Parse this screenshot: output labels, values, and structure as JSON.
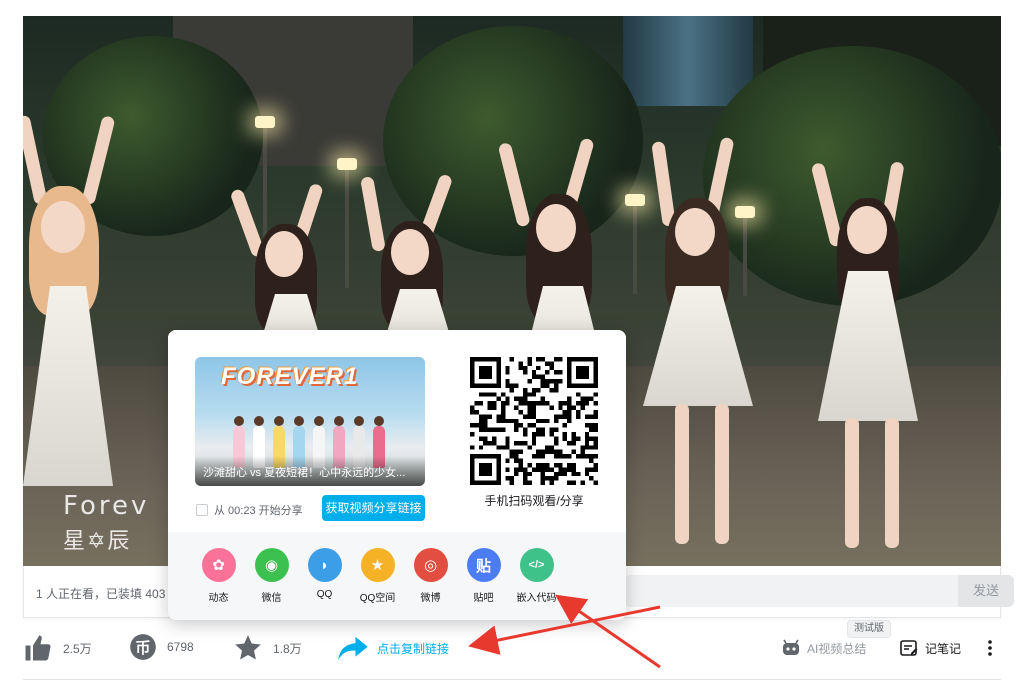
{
  "video": {
    "watermark_title": "Forev",
    "watermark_sub": "星✡辰",
    "progress_fraction": 0.0
  },
  "danmaku_bar": {
    "viewers_text": "1 人正在看，已装填 403",
    "send_label": "发送"
  },
  "share_popup": {
    "thumb_logo": "FOREVER1",
    "thumb_caption": "沙滩甜心 vs 夏夜短裙！心中永远的少女...",
    "start_share_label": "从 00:23 开始分享",
    "get_link_label": "获取视频分享链接",
    "qr_label": "手机扫码观看/分享",
    "apps": [
      {
        "label": "动态",
        "icon": "pinwheel-icon",
        "color": "#fb7299"
      },
      {
        "label": "微信",
        "icon": "wechat-icon",
        "color": "#3cc04f"
      },
      {
        "label": "QQ",
        "icon": "qq-icon",
        "color": "#3d9ee8"
      },
      {
        "label": "QQ空间",
        "icon": "qzone-star-icon",
        "color": "#f5b226"
      },
      {
        "label": "微博",
        "icon": "weibo-icon",
        "color": "#e24e3f"
      },
      {
        "label": "贴吧",
        "icon": "tieba-icon",
        "color": "#4c7cf2"
      },
      {
        "label": "嵌入代码",
        "icon": "embed-code-icon",
        "color": "#3fc28a"
      }
    ]
  },
  "actions": {
    "like_count": "2.5万",
    "coin_count": "6798",
    "fav_count": "1.8万",
    "copy_link_label": "点击复制链接",
    "beta_badge": "测试版",
    "ai_summary_label": "AI视频总结",
    "notes_label": "记笔记"
  },
  "colors": {
    "accent": "#00aeec",
    "annotation_arrow": "#e8392f"
  }
}
